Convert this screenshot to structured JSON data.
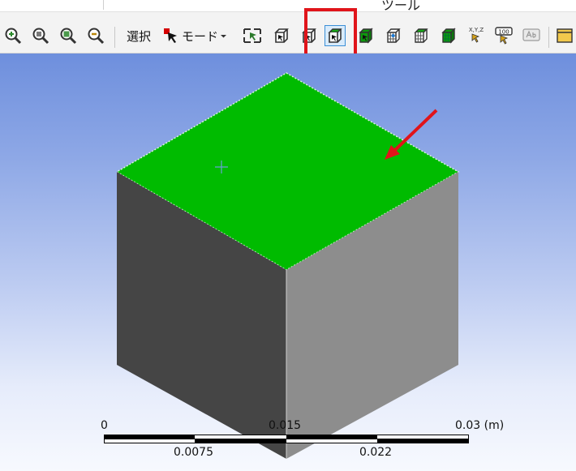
{
  "ribbon": {
    "group_label": "ツール"
  },
  "toolbar": {
    "select_label": "選択",
    "mode_label": "モード",
    "buttons": [
      {
        "icon": "zoom-in-icon"
      },
      {
        "icon": "zoom-fit-icon"
      },
      {
        "icon": "zoom-box-icon"
      },
      {
        "icon": "zoom-out-icon"
      }
    ],
    "xyz_label": "X,Y,Z",
    "coord_label": "100"
  },
  "scale_bar": {
    "top_labels": [
      "0",
      "0.015",
      "0.03 (m)"
    ],
    "bottom_labels": [
      "0.0075",
      "0.022"
    ]
  },
  "colors": {
    "highlight": "#e0141a",
    "face_top": "#00bb00",
    "face_left": "#454545",
    "face_right": "#8d8d8d",
    "arrow": "#e0141a"
  }
}
